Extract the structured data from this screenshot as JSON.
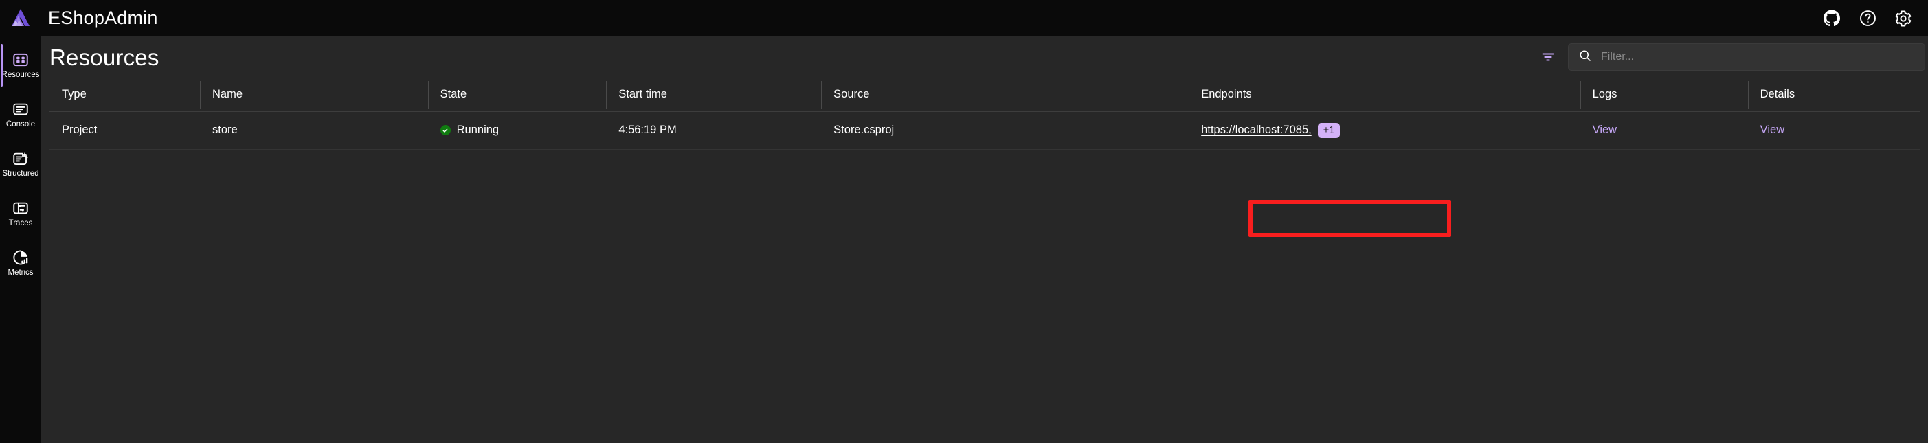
{
  "app": {
    "title": "EShopAdmin",
    "logo_icon": "aspire-logo-icon"
  },
  "topbar": {
    "actions": [
      {
        "name": "github-icon",
        "label": "GitHub"
      },
      {
        "name": "help-icon",
        "label": "Help"
      },
      {
        "name": "settings-gear-icon",
        "label": "Settings"
      }
    ]
  },
  "sidebar": {
    "items": [
      {
        "label": "Resources",
        "icon": "grid-four-squares-icon",
        "active": true
      },
      {
        "label": "Console",
        "icon": "console-log-icon",
        "active": false
      },
      {
        "label": "Structured",
        "icon": "structured-log-sparkle-icon",
        "active": false
      },
      {
        "label": "Traces",
        "icon": "traces-gantt-icon",
        "active": false
      },
      {
        "label": "Metrics",
        "icon": "metrics-pie-chart-icon",
        "active": false
      }
    ]
  },
  "page": {
    "title": "Resources",
    "filter_icon": "filter-lines-icon",
    "search": {
      "icon": "search-magnifier-icon",
      "value": "",
      "placeholder": "Filter..."
    }
  },
  "table": {
    "columns": [
      "Type",
      "Name",
      "State",
      "Start time",
      "Source",
      "Endpoints",
      "Logs",
      "Details"
    ],
    "rows": [
      {
        "type": "Project",
        "name": "store",
        "state": "Running",
        "state_icon": "checkmark-circle-icon",
        "start_time": "4:56:19 PM",
        "source": "Store.csproj",
        "endpoint_url": "https://localhost:7085,",
        "endpoint_more_badge": "+1",
        "logs_link": "View",
        "details_link": "View"
      }
    ]
  },
  "colors": {
    "accent_purple": "#b794f4",
    "link_purple": "#c4a6f5",
    "badge_purple": "#d3b1f7",
    "status_green": "#107c10",
    "highlight_red": "#f81e1e",
    "panel_bg": "#272727",
    "chrome_bg": "#0a0a0a"
  },
  "annotation": {
    "highlight_target": "endpoint-url-link"
  }
}
